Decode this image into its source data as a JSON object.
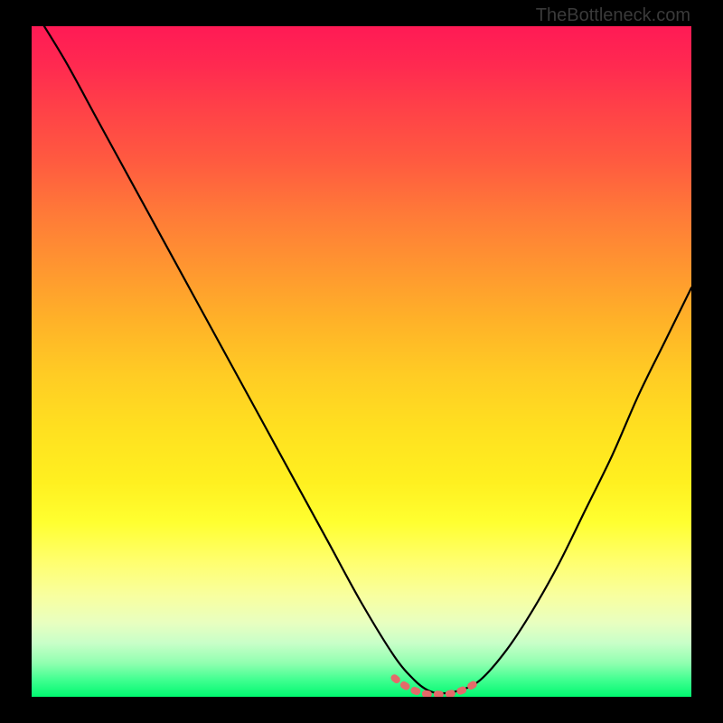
{
  "watermark": "TheBottleneck.com",
  "chart_data": {
    "type": "line",
    "title": "",
    "xlabel": "",
    "ylabel": "",
    "xlim": [
      0,
      100
    ],
    "ylim": [
      0,
      100
    ],
    "grid": false,
    "curve_style": {
      "color": "#000000",
      "width": 2
    },
    "series": [
      {
        "name": "bottleneck-curve",
        "x": [
          0,
          5,
          10,
          15,
          20,
          25,
          30,
          35,
          40,
          45,
          50,
          55,
          58,
          60,
          62,
          65,
          68,
          72,
          76,
          80,
          84,
          88,
          92,
          96,
          100
        ],
        "values": [
          103,
          95,
          86,
          77,
          68,
          59,
          50,
          41,
          32,
          23,
          14,
          6,
          2.5,
          1,
          0.5,
          1,
          2.5,
          7,
          13,
          20,
          28,
          36,
          45,
          53,
          61
        ]
      }
    ],
    "annotations": [
      {
        "name": "optimal-range-marker",
        "type": "dotted-arc",
        "color": "#e46a6a",
        "x_range": [
          55,
          68
        ],
        "y_approx": 2
      }
    ],
    "background_gradient": {
      "direction": "vertical",
      "stops": [
        {
          "pos": 0,
          "color": "#ff1a55"
        },
        {
          "pos": 0.5,
          "color": "#ffcc24"
        },
        {
          "pos": 0.78,
          "color": "#ffff40"
        },
        {
          "pos": 1.0,
          "color": "#00f870"
        }
      ]
    }
  }
}
